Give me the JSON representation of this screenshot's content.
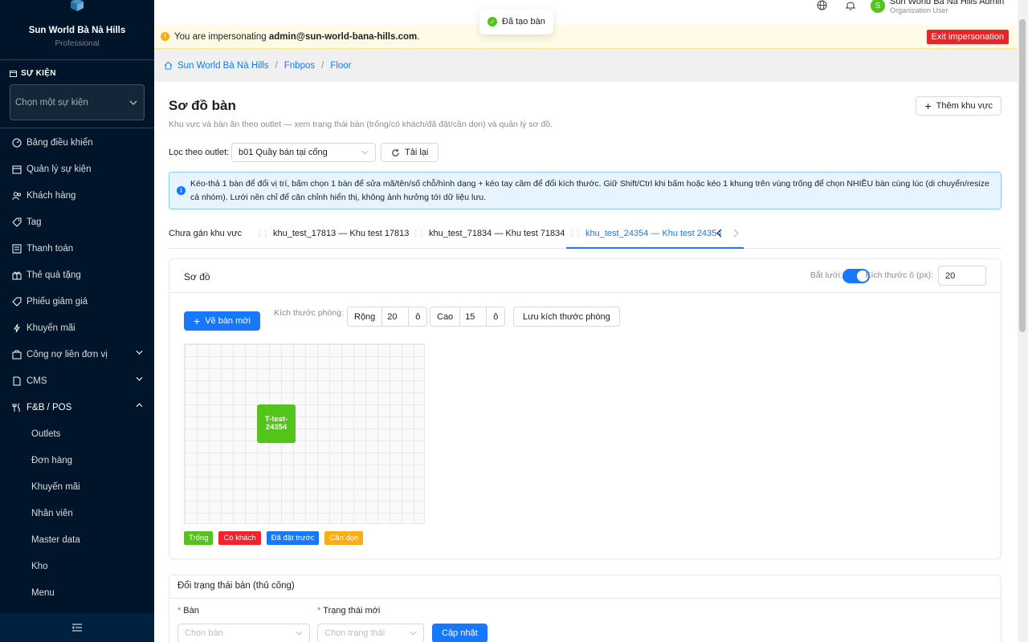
{
  "sidebar": {
    "brand_name": "Sun World Bà Nà Hills",
    "brand_sub": "Professional",
    "section_title": "SỰ KIỆN",
    "event_placeholder": "Chọn một sự kiện",
    "items": [
      {
        "label": "Bảng điều khiển",
        "icon": "dashboard-icon"
      },
      {
        "label": "Quản lý sự kiện",
        "icon": "calendar-icon"
      },
      {
        "label": "Khách hàng",
        "icon": "users-icon"
      },
      {
        "label": "Tag",
        "icon": "tag-icon"
      },
      {
        "label": "Thanh toán",
        "icon": "payment-icon"
      },
      {
        "label": "Thẻ quà tặng",
        "icon": "gift-icon"
      },
      {
        "label": "Phiếu giảm giá",
        "icon": "coupon-icon"
      },
      {
        "label": "Khuyến mãi",
        "icon": "promo-icon"
      },
      {
        "label": "Công nợ liên đơn vị",
        "icon": "debt-icon"
      },
      {
        "label": "CMS",
        "icon": "cms-icon"
      },
      {
        "label": "F&B / POS",
        "icon": "pos-icon"
      }
    ],
    "fnb_children": [
      "Outlets",
      "Đơn hàng",
      "Khuyến mãi",
      "Nhân viên",
      "Master data",
      "Kho",
      "Menu"
    ]
  },
  "topbar": {
    "user_name": "Sun World Bà Nà Hills Admin",
    "user_role": "Organization User",
    "avatar_letter": "S"
  },
  "impersonation": {
    "prefix": "You are impersonating",
    "email": "admin@sun-world-bana-hills.com",
    "suffix": ".",
    "exit_label": "Exit impersonation"
  },
  "toast": {
    "message": "Đã tạo bàn"
  },
  "breadcrumb": [
    "Sun World Bà Nà Hills",
    "Fnbpos",
    "Floor"
  ],
  "page": {
    "title": "Sơ đồ bàn",
    "description": "Khu vực và bàn ăn theo outlet — xem trạng thái bàn (trống/có khách/đã đặt/cần dọn) và quản lý sơ đồ.",
    "add_area_label": "Thêm khu vực",
    "filter_label": "Lọc theo outlet:",
    "outlet_value": "b01 Quầy bán tại cổng",
    "reload_label": "Tải lại",
    "info_text": "Kéo-thả 1 bàn để đổi vị trí, bấm chọn 1 bàn để sửa mã/tên/số chỗ/hình dạng + kéo tay cầm để đổi kích thước. Giữ Shift/Ctrl khi bấm hoặc kéo 1 khung trên vùng trống để chọn NHIỀU bàn cùng lúc (di chuyển/resize cả nhóm). Lưới nền chỉ để căn chỉnh hiển thị, không ảnh hưởng tới dữ liệu lưu."
  },
  "tabs": [
    {
      "label": "Chưa gán khu vực",
      "active": false
    },
    {
      "label": "khu_test_17813 — Khu test 17813",
      "active": false
    },
    {
      "label": "khu_test_71834 — Khu test 71834",
      "active": false
    },
    {
      "label": "khu_test_24354 — Khu test 24354",
      "active": true
    }
  ],
  "floor": {
    "title": "Sơ đồ",
    "grid_label": "Bắt lưới:",
    "grid_on": true,
    "cell_size_label": "Kích thước ô (px):",
    "cell_size": "20",
    "draw_table_label": "Vẽ bàn mới",
    "room_size_label": "Kích thước phòng:",
    "width_label": "Rộng",
    "width_value": "20",
    "height_label": "Cao",
    "height_value": "15",
    "unit": "ô",
    "save_room_label": "Lưu kích thước phòng",
    "tables": [
      {
        "code": "T-test-24354",
        "status": "trong"
      }
    ],
    "legend": [
      {
        "label": "Trống",
        "color": "#52c41a"
      },
      {
        "label": "Có khách",
        "color": "#f5222d"
      },
      {
        "label": "Đã đặt trước",
        "color": "#1677ff"
      },
      {
        "label": "Cần dọn",
        "color": "#faad14"
      }
    ]
  },
  "status_form": {
    "title": "Đổi trạng thái bàn (thủ công)",
    "table_label": "Bàn",
    "table_placeholder": "Chọn bàn",
    "status_label": "Trạng thái mới",
    "status_placeholder": "Chọn trạng thái",
    "submit_label": "Cập nhật"
  }
}
